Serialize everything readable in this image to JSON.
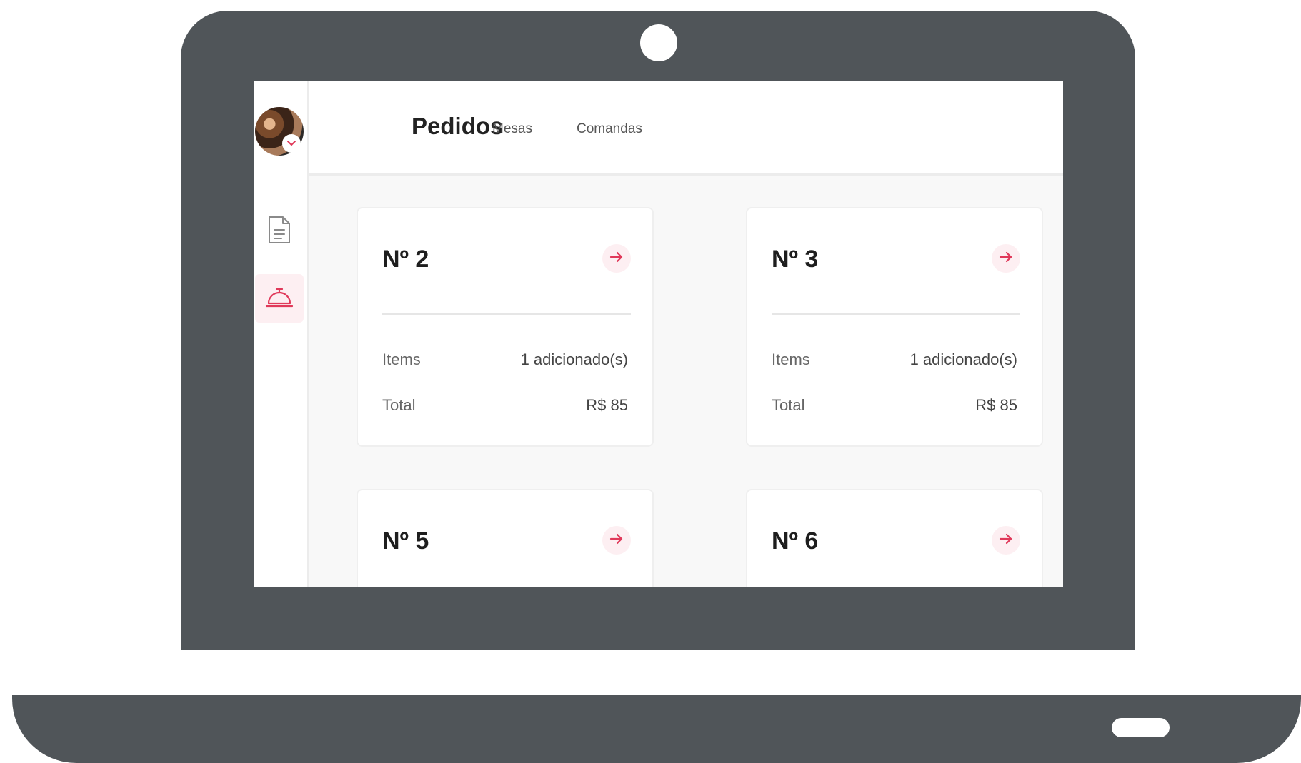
{
  "colors": {
    "laptop": "#505559",
    "accent": "#e0395a",
    "accent_soft": "#fdeff2",
    "screen_bg": "#f8f8f8"
  },
  "sidebar": {
    "avatar_badge_icon": "chevron-down-icon",
    "items": [
      {
        "icon": "document-icon",
        "active": false
      },
      {
        "icon": "food-cloche-icon",
        "active": true
      }
    ]
  },
  "header": {
    "title": "Pedidos",
    "tabs": [
      {
        "label": "Mesas"
      },
      {
        "label": "Comandas"
      }
    ]
  },
  "orders": [
    {
      "title": "Nº 2",
      "items_label": "Items",
      "items_value": "1 adicionado(s)",
      "total_label": "Total",
      "total_value": "R$ 85"
    },
    {
      "title": "Nº 3",
      "items_label": "Items",
      "items_value": "1 adicionado(s)",
      "total_label": "Total",
      "total_value": "R$ 85"
    },
    {
      "title": "Nº 5"
    },
    {
      "title": "Nº 6"
    }
  ]
}
